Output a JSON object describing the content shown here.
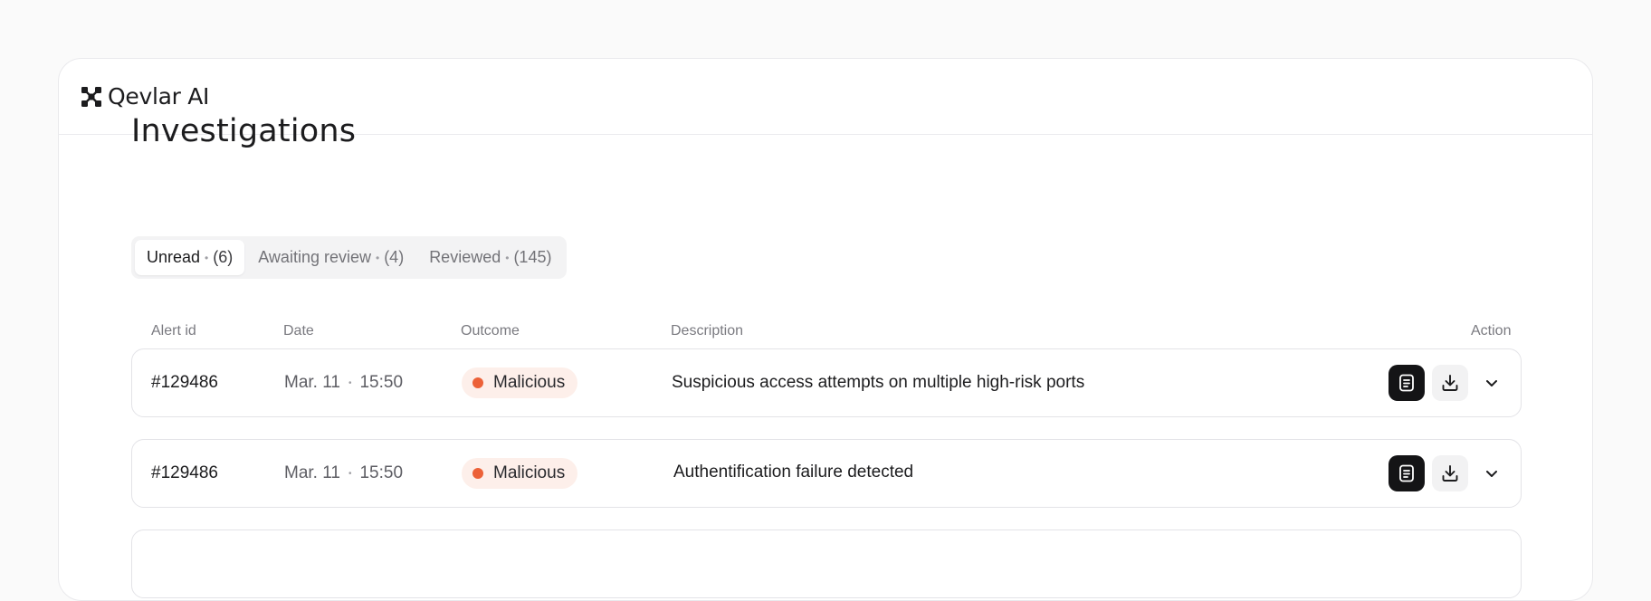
{
  "app": {
    "name": "Qevlar AI"
  },
  "page": {
    "title": "Investigations"
  },
  "tabs": [
    {
      "label": "Unread",
      "count": "(6)"
    },
    {
      "label": "Awaiting review",
      "count": "(4)"
    },
    {
      "label": "Reviewed",
      "count": "(145)"
    }
  ],
  "table": {
    "headers": {
      "alert_id": "Alert id",
      "date": "Date",
      "outcome": "Outcome",
      "description": "Description",
      "action": "Action"
    },
    "rows": [
      {
        "alert_id": "#129486",
        "date": "Mar. 11",
        "time": "15:50",
        "outcome": "Malicious",
        "description": "Suspicious access attempts on multiple high-risk ports"
      },
      {
        "alert_id": "#129486",
        "date": "Mar. 11",
        "time": "15:50",
        "outcome": "Malicious",
        "description": "Authentification failure detected"
      }
    ]
  },
  "colors": {
    "malicious": "#ec6138",
    "malicious_bg": "#fdefea",
    "primary_button": "#141416"
  },
  "icons": {
    "logo": "qevlar-logo-icon",
    "report": "report-icon",
    "download": "download-icon",
    "expand": "chevron-down-icon"
  }
}
